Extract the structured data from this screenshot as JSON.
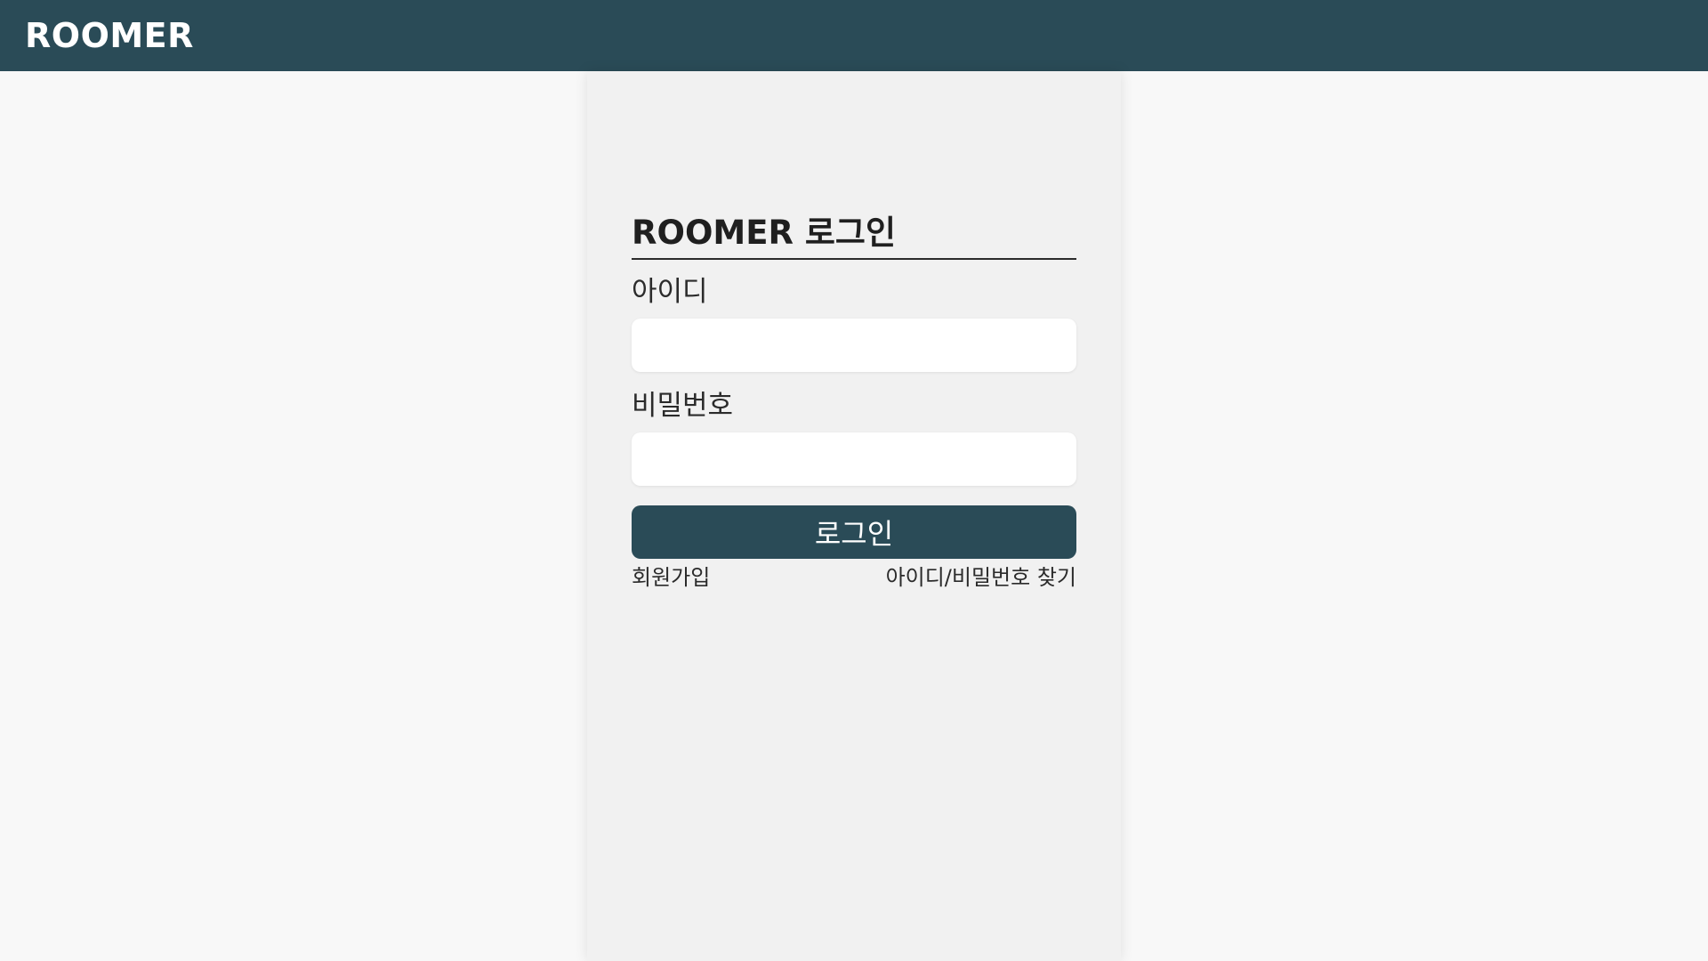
{
  "header": {
    "brand": "ROOMER"
  },
  "login_form": {
    "title": "ROOMER 로그인",
    "id_label": "아이디",
    "id_value": "",
    "password_label": "비밀번호",
    "password_value": "",
    "submit_label": "로그인",
    "signup_link": "회원가입",
    "find_account_link": "아이디/비밀번호 찾기"
  },
  "colors": {
    "brand_primary": "#2a4b57",
    "page_background": "#f8f8f8",
    "panel_background": "#f1f1f1"
  }
}
